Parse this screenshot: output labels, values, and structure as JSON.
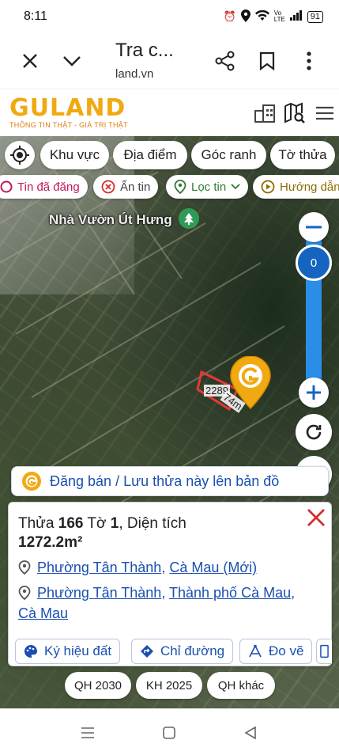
{
  "status_bar": {
    "time": "8:11",
    "signal_label": "Vo LTE",
    "battery": "91"
  },
  "browser": {
    "title": "Tra c...",
    "url": "land.vn"
  },
  "site": {
    "logo": "GULAND",
    "slogan": "THÔNG TIN THẬT - GIÁ TRỊ THẬT"
  },
  "map_filters": [
    "Khu vực",
    "Địa điểm",
    "Góc ranh",
    "Tờ thửa"
  ],
  "map_options": [
    "Tin đã đăng",
    "Ẩn tin",
    "Lọc tin",
    "Hướng dẫn"
  ],
  "poi": {
    "name": "Nhà Vườn Út Hưng"
  },
  "zoom": {
    "level": "0"
  },
  "parcel_labels": [
    "2289",
    "74m"
  ],
  "post_banner": "Đăng bán / Lưu thửa này lên bản đồ",
  "card": {
    "thua_label": "Thửa",
    "thua_value": "166",
    "to_label": "Tờ",
    "to_value": "1",
    "area_label": ", Diện tích",
    "area_value": "1272.2m²",
    "loc_new": {
      "ward": "Phường Tân Thành",
      "province": "Cà Mau (Mới)"
    },
    "loc_old": {
      "ward": "Phường Tân Thành",
      "city": "Thành phố Cà Mau",
      "province": "Cà Mau"
    },
    "actions": [
      "Ký hiệu đất",
      "Chỉ đường",
      "Đo vẽ"
    ]
  },
  "plan_buttons": [
    "QH 2030",
    "KH 2025",
    "QH khác"
  ],
  "colors": {
    "brand": "#f1a912",
    "link": "#1a4fb0",
    "zoom": "#1565c0",
    "close": "#d32f2f"
  }
}
